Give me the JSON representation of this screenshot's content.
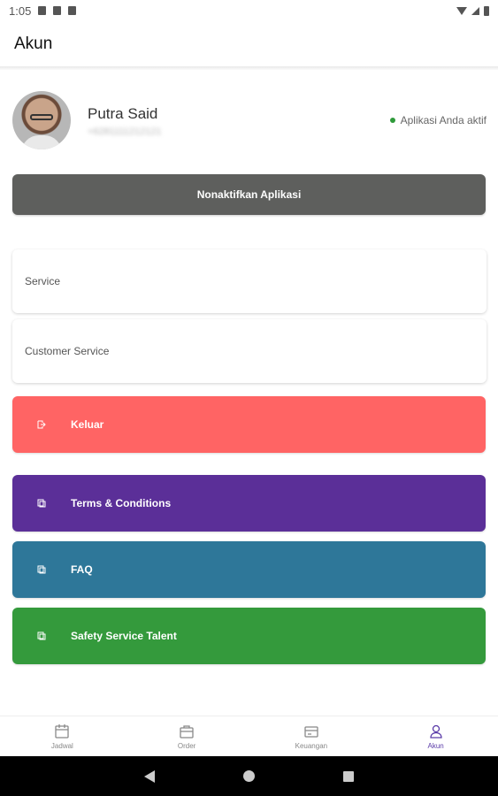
{
  "status_bar": {
    "time": "1:05"
  },
  "appbar": {
    "title": "Akun"
  },
  "profile": {
    "name": "Putra Said",
    "phone": "+6281111212121",
    "status_text": "Aplikasi Anda aktif",
    "status_color": "#2e9a3a"
  },
  "deactivate_button": {
    "label": "Nonaktifkan Aplikasi",
    "color": "#5e5f5d"
  },
  "menu_cards": [
    {
      "label": "Service"
    },
    {
      "label": "Customer Service"
    }
  ],
  "actions": [
    {
      "label": "Keluar",
      "icon": "logout-icon",
      "color": "#ff6464"
    },
    {
      "label": "Terms & Conditions",
      "icon": "document-icon",
      "color": "#5b2f98"
    },
    {
      "label": "FAQ",
      "icon": "document-icon",
      "color": "#2e7799"
    },
    {
      "label": "Safety Service Talent",
      "icon": "document-icon",
      "color": "#349a3c"
    }
  ],
  "bottom_nav": [
    {
      "label": "Jadwal",
      "icon": "calendar-icon",
      "active": false
    },
    {
      "label": "Order",
      "icon": "briefcase-icon",
      "active": false
    },
    {
      "label": "Keuangan",
      "icon": "wallet-icon",
      "active": false
    },
    {
      "label": "Akun",
      "icon": "person-icon",
      "active": true
    }
  ],
  "accent_color": "#5a3aa8"
}
